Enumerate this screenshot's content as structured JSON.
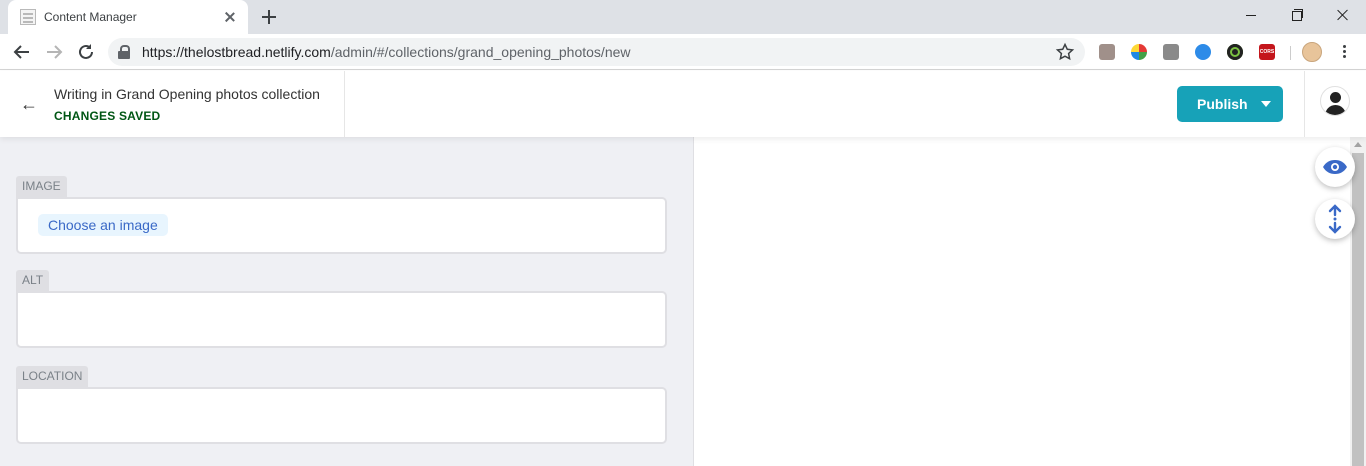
{
  "browser": {
    "tab_title": "Content Manager",
    "url_host": "https://thelostbread.netlify.com",
    "url_path": "/admin/#/collections/grand_opening_photos/new",
    "extensions": [
      "pdf-icon",
      "color-picker-icon",
      "camera-icon",
      "ethereum-icon",
      "dark-reader-icon",
      "cors-icon"
    ],
    "cors_label": "CORS"
  },
  "header": {
    "title": "Writing in Grand Opening photos collection",
    "status": "CHANGES SAVED",
    "publish_label": "Publish",
    "back_arrow": "←"
  },
  "fields": [
    {
      "label": "IMAGE",
      "button": "Choose an image"
    },
    {
      "label": "ALT"
    },
    {
      "label": "LOCATION"
    }
  ],
  "colors": {
    "publish": "#17a2b8",
    "status": "#005614",
    "editor_bg": "#eff0f4",
    "label_bg": "#dfdfe3",
    "choose_text": "#3a69c7",
    "preview_icon": "#3a69c7"
  }
}
